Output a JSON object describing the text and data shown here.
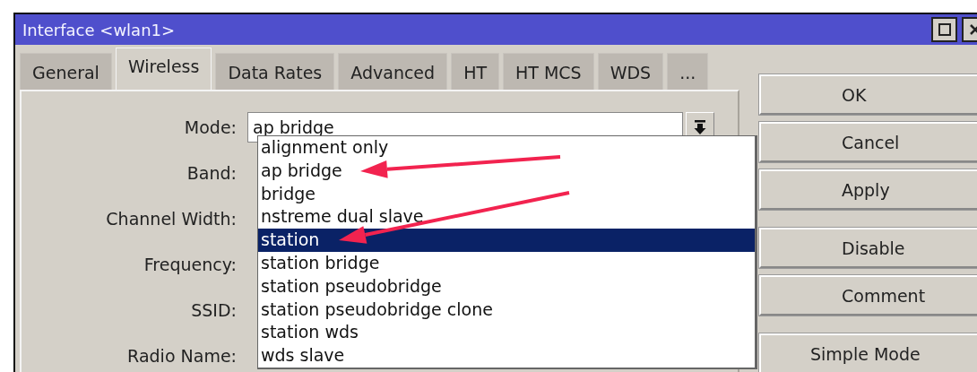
{
  "window": {
    "title": "Interface <wlan1>"
  },
  "tabs": [
    {
      "label": "General",
      "selected": false
    },
    {
      "label": "Wireless",
      "selected": true
    },
    {
      "label": "Data Rates",
      "selected": false
    },
    {
      "label": "Advanced",
      "selected": false
    },
    {
      "label": "HT",
      "selected": false
    },
    {
      "label": "HT MCS",
      "selected": false
    },
    {
      "label": "WDS",
      "selected": false
    },
    {
      "label": "...",
      "selected": false
    }
  ],
  "fields": [
    {
      "label": "Mode:",
      "value": "ap bridge"
    },
    {
      "label": "Band:"
    },
    {
      "label": "Channel Width:"
    },
    {
      "label": "Frequency:"
    },
    {
      "label": "SSID:"
    },
    {
      "label": "Radio Name:"
    }
  ],
  "mode_dropdown": {
    "expanded": true,
    "options": [
      {
        "label": "alignment only",
        "selected": false
      },
      {
        "label": "ap bridge",
        "selected": false
      },
      {
        "label": "bridge",
        "selected": false
      },
      {
        "label": "nstreme dual slave",
        "selected": false
      },
      {
        "label": "station",
        "selected": true
      },
      {
        "label": "station bridge",
        "selected": false
      },
      {
        "label": "station pseudobridge",
        "selected": false
      },
      {
        "label": "station pseudobridge clone",
        "selected": false
      },
      {
        "label": "station wds",
        "selected": false
      },
      {
        "label": "wds slave",
        "selected": false
      }
    ]
  },
  "button_groups": [
    [
      "OK",
      "Cancel",
      "Apply"
    ],
    [
      "Disable",
      "Comment"
    ],
    [
      "Simple Mode"
    ]
  ]
}
